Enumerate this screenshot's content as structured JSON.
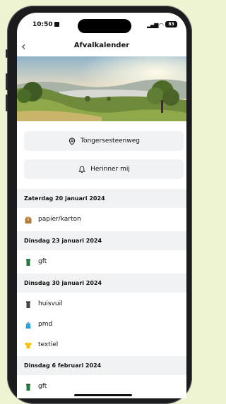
{
  "status_bar": {
    "time": "10:50",
    "battery": "83"
  },
  "header": {
    "title": "Afvalkalender"
  },
  "actions": {
    "location_label": "Tongersesteenweg",
    "reminder_label": "Herinner mij"
  },
  "schedule": [
    {
      "date": "Zaterdag 20 januari 2024",
      "items": [
        {
          "label": "papier/karton",
          "icon": "cardboard-box-icon",
          "color": "#b07a3a"
        }
      ]
    },
    {
      "date": "Dinsdag 23 januari 2024",
      "items": [
        {
          "label": "gft",
          "icon": "green-bin-icon",
          "color": "#1f7a3a"
        }
      ]
    },
    {
      "date": "Dinsdag 30 januari 2024",
      "items": [
        {
          "label": "huisvuil",
          "icon": "grey-bin-icon",
          "color": "#444444"
        },
        {
          "label": "pmd",
          "icon": "blue-bag-icon",
          "color": "#2aa6d6"
        },
        {
          "label": "textiel",
          "icon": "tshirt-icon",
          "color": "#f5c400"
        }
      ]
    },
    {
      "date": "Dinsdag 6 februari 2024",
      "items": [
        {
          "label": "gft",
          "icon": "green-bin-icon",
          "color": "#1f7a3a"
        }
      ]
    }
  ]
}
